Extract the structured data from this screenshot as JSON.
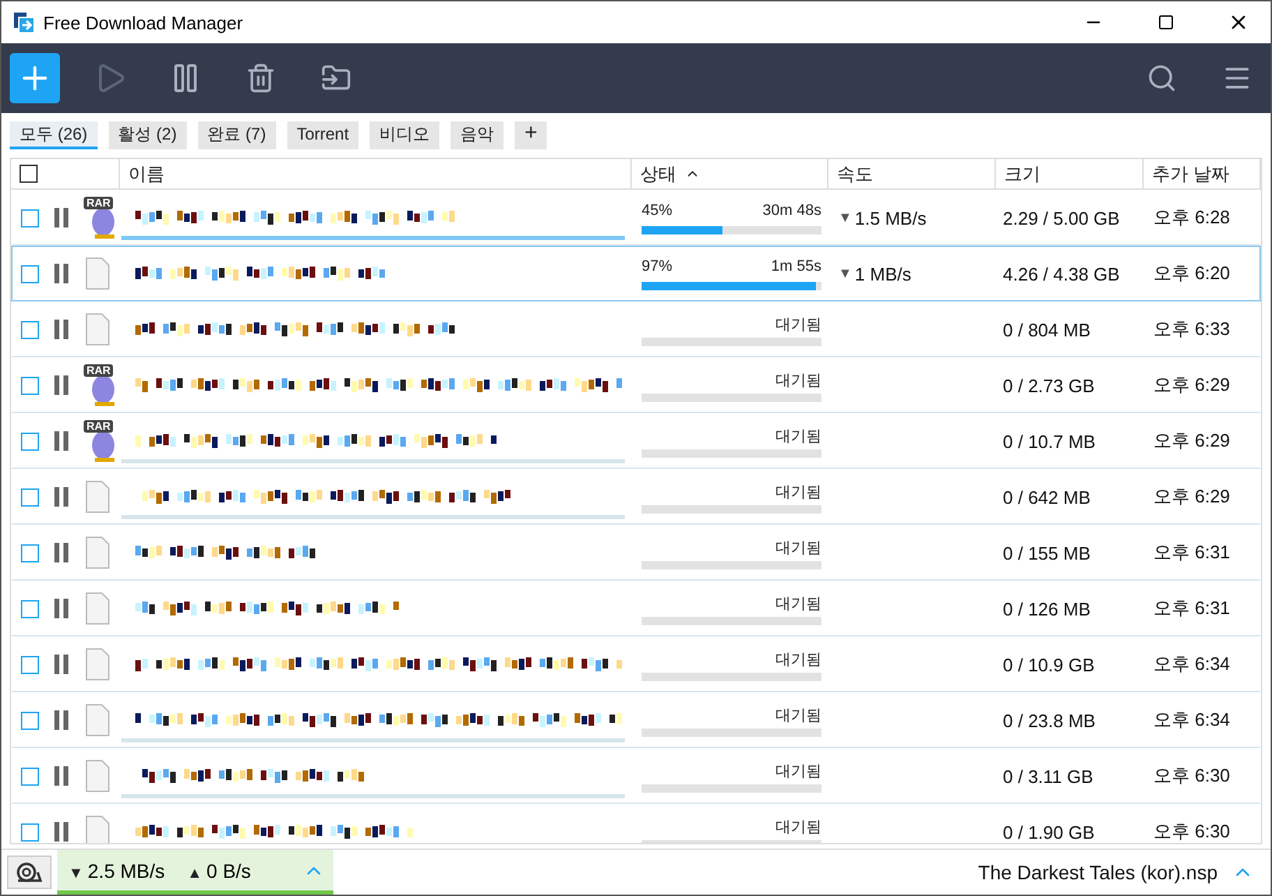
{
  "window": {
    "title": "Free Download Manager"
  },
  "tabs": [
    {
      "label": "모두 (26)",
      "selected": true
    },
    {
      "label": "활성 (2)",
      "selected": false
    },
    {
      "label": "완료 (7)",
      "selected": false
    },
    {
      "label": "Torrent",
      "selected": false
    },
    {
      "label": "비디오",
      "selected": false
    },
    {
      "label": "음악",
      "selected": false
    }
  ],
  "add_tab": "+",
  "table": {
    "select_all_checked": false,
    "columns": [
      {
        "label": "이름",
        "sorted": false
      },
      {
        "label": "상태",
        "sorted": true
      },
      {
        "label": "속도",
        "sorted": false
      },
      {
        "label": "크기",
        "sorted": false
      },
      {
        "label": "추가 날짜",
        "sorted": false
      }
    ],
    "rows": [
      {
        "file": {
          "kind": "rar",
          "label": "RAR"
        },
        "underline": {
          "kind": "active"
        },
        "selected": false,
        "checked": false,
        "kind": "progress",
        "percent": "45%",
        "eta": "30m 48s",
        "level": 0.45,
        "speed_arrow": "▼",
        "speed": "1.5 MB/s",
        "size": "2.29 / 5.00 GB",
        "added": "오후 6:28"
      },
      {
        "file": {
          "kind": "doc"
        },
        "selected": true,
        "checked": false,
        "kind": "progress",
        "percent": "97%",
        "eta": "1m 55s",
        "level": 0.97,
        "speed_arrow": "▼",
        "speed": "1 MB/s",
        "size": "4.26 / 4.38 GB",
        "added": "오후 6:20"
      },
      {
        "file": {
          "kind": "doc"
        },
        "selected": false,
        "checked": false,
        "kind": "waiting",
        "status": "대기됨",
        "level": 0,
        "size": "0 / 804 MB",
        "added": "오후 6:33"
      },
      {
        "file": {
          "kind": "rar",
          "label": "RAR"
        },
        "selected": false,
        "checked": false,
        "kind": "waiting",
        "status": "대기됨",
        "level": 0,
        "size": "0 / 2.73 GB",
        "added": "오후 6:29"
      },
      {
        "file": {
          "kind": "rar",
          "label": "RAR"
        },
        "underline": {
          "kind": "idle"
        },
        "selected": false,
        "checked": false,
        "kind": "waiting",
        "status": "대기됨",
        "level": 0,
        "size": "0 / 10.7 MB",
        "added": "오후 6:29"
      },
      {
        "file": {
          "kind": "doc"
        },
        "underline": {
          "kind": "idle"
        },
        "selected": false,
        "checked": false,
        "kind": "waiting",
        "status": "대기됨",
        "level": 0,
        "size": "0 / 642 MB",
        "added": "오후 6:29"
      },
      {
        "file": {
          "kind": "doc"
        },
        "selected": false,
        "checked": false,
        "kind": "waiting",
        "status": "대기됨",
        "level": 0,
        "size": "0 / 155 MB",
        "added": "오후 6:31"
      },
      {
        "file": {
          "kind": "doc"
        },
        "selected": false,
        "checked": false,
        "kind": "waiting",
        "status": "대기됨",
        "level": 0,
        "size": "0 / 126 MB",
        "added": "오후 6:31"
      },
      {
        "file": {
          "kind": "doc"
        },
        "selected": false,
        "checked": false,
        "kind": "waiting",
        "status": "대기됨",
        "level": 0,
        "size": "0 / 10.9 GB",
        "added": "오후 6:34"
      },
      {
        "file": {
          "kind": "doc"
        },
        "underline": {
          "kind": "idle"
        },
        "selected": false,
        "checked": false,
        "kind": "waiting",
        "status": "대기됨",
        "level": 0,
        "size": "0 / 23.8 MB",
        "added": "오후 6:34"
      },
      {
        "file": {
          "kind": "doc"
        },
        "underline": {
          "kind": "idle"
        },
        "selected": false,
        "checked": false,
        "kind": "waiting",
        "status": "대기됨",
        "level": 0,
        "size": "0 / 3.11 GB",
        "added": "오후 6:30"
      },
      {
        "file": {
          "kind": "doc"
        },
        "selected": false,
        "checked": false,
        "kind": "waiting",
        "status": "대기됨",
        "level": 0,
        "size": "0 / 1.90 GB",
        "added": "오후 6:30"
      }
    ]
  },
  "status_bar": {
    "download_arrow": "▼",
    "download": "2.5 MB/s",
    "upload_arrow": "▲",
    "upload": "0 B/s",
    "current": "The Darkest Tales (kor).nsp"
  }
}
